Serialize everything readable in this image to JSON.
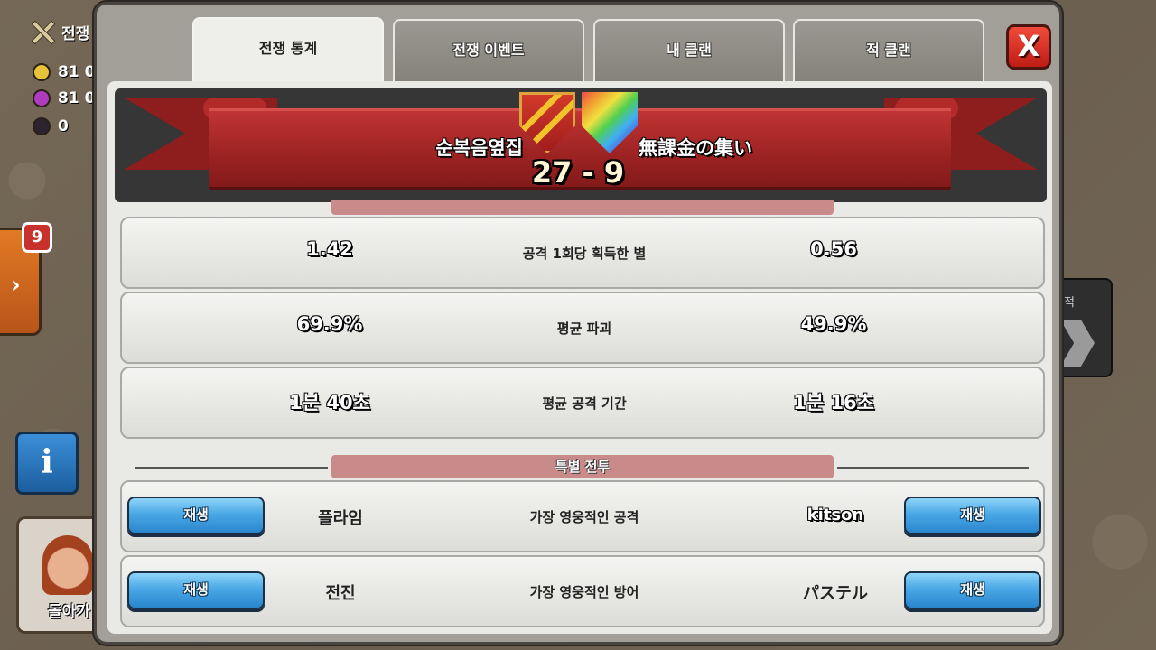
{
  "hud": {
    "war_label": "전쟁",
    "gold": "81 0",
    "elixir": "81 0",
    "dark_elixir": "0"
  },
  "sidebar": {
    "badge_count": "9",
    "info_icon_glyph": "i",
    "return_label": "돌아가",
    "enemy_label": "적"
  },
  "tabs": [
    {
      "label": "전쟁 통계",
      "active": true
    },
    {
      "label": "전쟁 이벤트",
      "active": false
    },
    {
      "label": "내 클랜",
      "active": false
    },
    {
      "label": "적 클랜",
      "active": false
    }
  ],
  "close_glyph": "X",
  "banner": {
    "left_clan": "순복음옆집",
    "right_clan": "無課金の集い",
    "score": "27 - 9"
  },
  "stats": [
    {
      "left": "1.42",
      "label": "공격 1회당 획득한 별",
      "right": "0.56"
    },
    {
      "left": "69.9%",
      "label": "평균 파괴",
      "right": "49.9%"
    },
    {
      "left": "1분 40초",
      "label": "평균 공격 기간",
      "right": "1분 16초"
    }
  ],
  "special": {
    "section_title": "특별 전투",
    "rows": [
      {
        "replay_left": "재생",
        "left_player": "플라임",
        "label": "가장 영웅적인 공격",
        "right_player": "kitson",
        "replay_right": "재생"
      },
      {
        "replay_left": "재생",
        "left_player": "전진",
        "label": "가장 영웅적인 방어",
        "right_player": "パステル",
        "replay_right": "재생"
      }
    ]
  },
  "colors": {
    "ribbon_red": "#9c2222",
    "section_pill": "#c98a8a",
    "replay_blue": "#4aa8e6",
    "close_red": "#e0342a"
  },
  "icons": [
    "swords-icon",
    "gold-icon",
    "elixir-icon",
    "dark-elixir-icon",
    "chevron-right-icon",
    "info-icon",
    "close-icon",
    "left-clan-badge-icon",
    "right-clan-badge-icon"
  ]
}
